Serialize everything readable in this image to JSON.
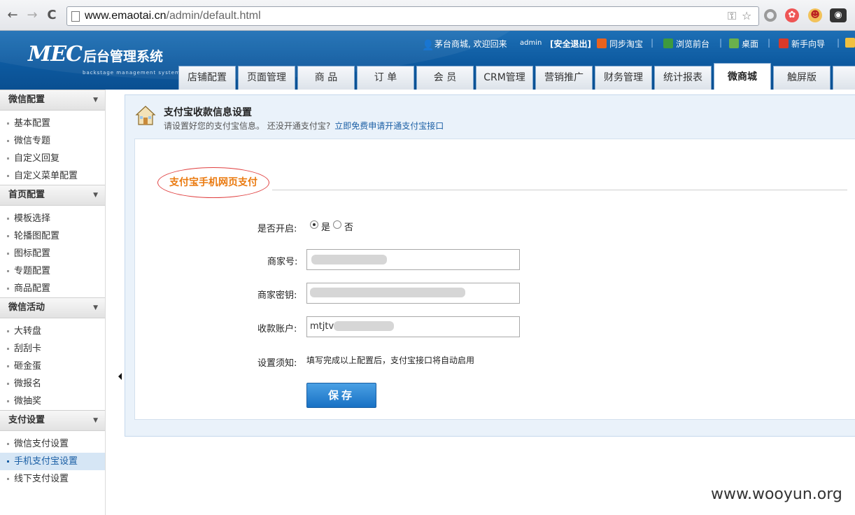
{
  "browser": {
    "back": "←",
    "forward": "→",
    "reload": "C",
    "url_host": "www.emaotai.cn",
    "url_path": "/admin/default.html"
  },
  "header": {
    "logo_mec": "MEC",
    "logo_cn": "后台管理系统",
    "logo_en": "backstage management system",
    "welcome": "茅台商城, 欢迎回来",
    "username": "admin",
    "logout": "[安全退出]",
    "sync_taobao": "同步淘宝",
    "browse_front": "浏览前台",
    "desktop": "桌面",
    "guide": "新手向导",
    "separator": "|"
  },
  "tabs": [
    "店铺配置",
    "页面管理",
    "商 品",
    "订 单",
    "会 员",
    "CRM管理",
    "营销推广",
    "财务管理",
    "统计报表",
    "微商城",
    "触屏版"
  ],
  "sidebar": {
    "groups": [
      {
        "title": "微信配置",
        "items": [
          "基本配置",
          "微信专题",
          "自定义回复",
          "自定义菜单配置"
        ]
      },
      {
        "title": "首页配置",
        "items": [
          "模板选择",
          "轮播图配置",
          "图标配置",
          "专题配置",
          "商品配置"
        ]
      },
      {
        "title": "微信活动",
        "items": [
          "大转盘",
          "刮刮卡",
          "砸金蛋",
          "微报名",
          "微抽奖"
        ]
      },
      {
        "title": "支付设置",
        "items": [
          "微信支付设置",
          "手机支付宝设置",
          "线下支付设置"
        ]
      }
    ],
    "caret": "▼"
  },
  "panel": {
    "title": "支付宝收款信息设置",
    "subtitle": "请设置好您的支付宝信息。 还没开通支付宝?",
    "apply_link": "立即免费申请开通支付宝接口",
    "section": "支付宝手机网页支付"
  },
  "form": {
    "enable_label": "是否开启:",
    "yes": "是",
    "no": "否",
    "enabled": true,
    "merchant_label": "商家号:",
    "key_label": "商家密钥:",
    "account_label": "收款账户:",
    "account_value": "mtjtv",
    "note_label": "设置须知:",
    "note_text": "填写完成以上配置后，支付宝接口将自动启用",
    "save": "保存"
  },
  "watermark": "www.wooyun.org"
}
